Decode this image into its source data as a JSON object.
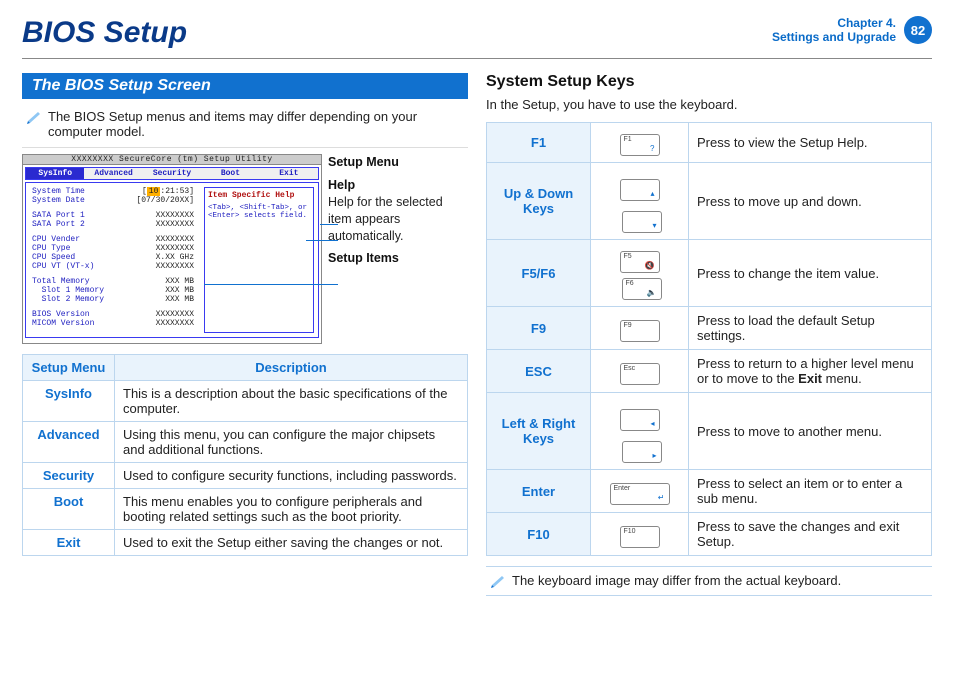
{
  "header": {
    "title": "BIOS Setup",
    "chapter_line1": "Chapter 4.",
    "chapter_line2": "Settings and Upgrade",
    "page": "82"
  },
  "left": {
    "section_title": "The BIOS Setup Screen",
    "note": "The BIOS Setup menus and items may differ depending on your computer model.",
    "bios": {
      "window_title": "XXXXXXXX SecureCore (tm) Setup Utility",
      "tabs": [
        "SysInfo",
        "Advanced",
        "Security",
        "Boot",
        "Exit"
      ],
      "help_header": "Item Specific Help",
      "help_text": "<Tab>, <Shift-Tab>, or <Enter> selects field.",
      "rows": [
        {
          "k": "System Time",
          "v": "[10:21:53]",
          "hl": true
        },
        {
          "k": "System Date",
          "v": "[07/30/20XX]"
        },
        {
          "sep": true
        },
        {
          "k": "SATA Port 1",
          "v": "XXXXXXXX"
        },
        {
          "k": "SATA Port 2",
          "v": "XXXXXXXX"
        },
        {
          "sep": true
        },
        {
          "k": "CPU Vender",
          "v": "XXXXXXXX"
        },
        {
          "k": "CPU Type",
          "v": "XXXXXXXX"
        },
        {
          "k": "CPU Speed",
          "v": "X.XX GHz"
        },
        {
          "k": "CPU VT (VT-x)",
          "v": "XXXXXXXX"
        },
        {
          "sep": true
        },
        {
          "k": "Total Memory",
          "v": "XXX MB"
        },
        {
          "k": "  Slot 1 Memory",
          "v": "XXX MB"
        },
        {
          "k": "  Slot 2 Memory",
          "v": "XXX MB"
        },
        {
          "sep": true
        },
        {
          "k": "BIOS Version",
          "v": "XXXXXXXX"
        },
        {
          "k": "MICOM Version",
          "v": "XXXXXXXX"
        }
      ]
    },
    "callouts": [
      {
        "lbl": "Setup Menu",
        "sub": ""
      },
      {
        "lbl": "Help",
        "sub": "Help for the selected item appears automatically."
      },
      {
        "lbl": "Setup Items",
        "sub": ""
      }
    ],
    "menu_table": {
      "headers": [
        "Setup Menu",
        "Description"
      ],
      "rows": [
        {
          "k": "SysInfo",
          "d": "This is a description about the basic specifications of the computer."
        },
        {
          "k": "Advanced",
          "d": "Using this menu, you can configure the major chipsets and additional functions."
        },
        {
          "k": "Security",
          "d": "Used to configure security functions, including passwords."
        },
        {
          "k": "Boot",
          "d": "This menu enables you to configure peripherals and booting related settings such as the boot priority."
        },
        {
          "k": "Exit",
          "d": "Used to exit the Setup either saving the changes or not."
        }
      ]
    }
  },
  "right": {
    "heading": "System Setup Keys",
    "lead": "In the Setup, you have to use the keyboard.",
    "keys": [
      {
        "k": "F1",
        "d": "Press to view the Setup Help.",
        "caps": [
          {
            "l": "F1",
            "s": "?"
          }
        ]
      },
      {
        "k": "Up & Down Keys",
        "d": "Press to move up and down.",
        "caps": [
          {
            "l": "",
            "s": "▴"
          },
          {
            "l": "",
            "s": "▾"
          }
        ]
      },
      {
        "k": "F5/F6",
        "d": "Press to change the item value.",
        "caps": [
          {
            "l": "F5",
            "s": "🔇"
          },
          {
            "l": "F6",
            "s": "🔈"
          }
        ]
      },
      {
        "k": "F9",
        "d": "Press to load the default Setup settings.",
        "caps": [
          {
            "l": "F9",
            "s": ""
          }
        ]
      },
      {
        "k": "ESC",
        "d": "Press to return to a higher level menu or to move to the ",
        "bold": "Exit",
        "tail": " menu.",
        "caps": [
          {
            "l": "Esc",
            "s": ""
          }
        ]
      },
      {
        "k": "Left & Right Keys",
        "d": "Press to move to another menu.",
        "caps": [
          {
            "l": "",
            "s": "◂"
          },
          {
            "l": "",
            "s": "▸"
          }
        ]
      },
      {
        "k": "Enter",
        "d": "Press to select an item or to enter a sub menu.",
        "caps": [
          {
            "l": "Enter",
            "s": "↵",
            "wide": true
          }
        ]
      },
      {
        "k": "F10",
        "d": "Press to save the changes and exit Setup.",
        "caps": [
          {
            "l": "F10",
            "s": ""
          }
        ]
      }
    ],
    "note": "The keyboard image may differ from the actual keyboard."
  }
}
